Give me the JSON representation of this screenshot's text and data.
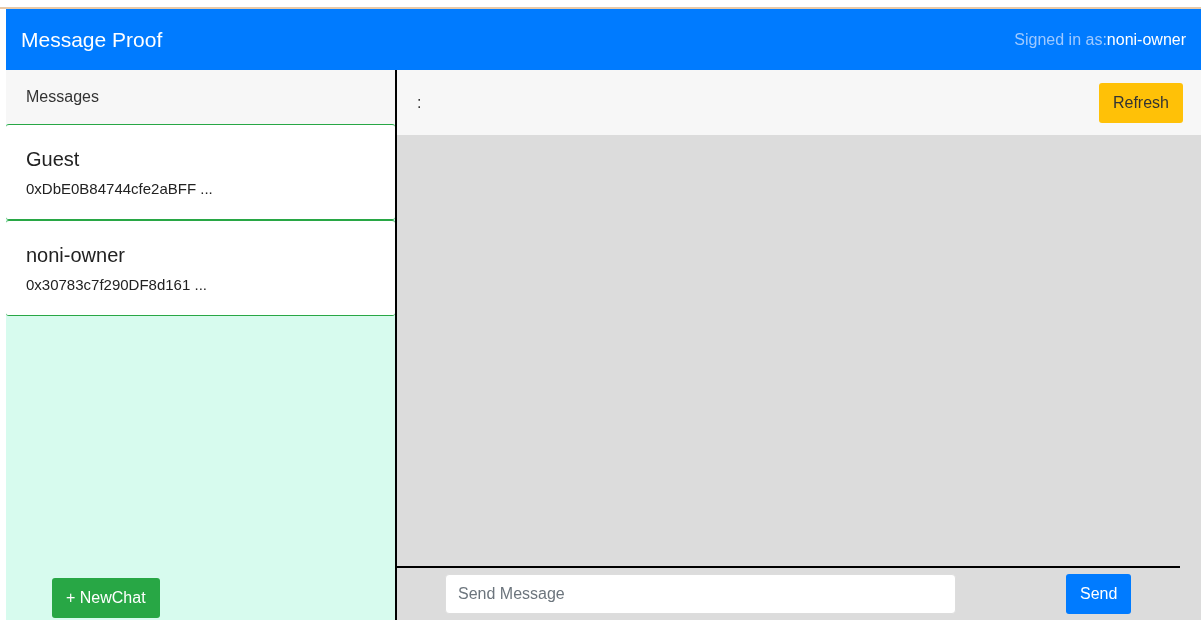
{
  "header": {
    "title": "Message Proof",
    "signed_in_label": "Signed in as:",
    "username": "noni-owner"
  },
  "sidebar": {
    "title": "Messages",
    "contacts": [
      {
        "name": "Guest",
        "address": "0xDbE0B84744cfe2aBFF ..."
      },
      {
        "name": "noni-owner",
        "address": "0x30783c7f290DF8d161 ..."
      }
    ],
    "new_chat_button": "+ NewChat"
  },
  "chat": {
    "header_text": ":",
    "refresh_button": "Refresh",
    "message_field": {
      "placeholder": "Send Message"
    },
    "send_button": "Send"
  }
}
